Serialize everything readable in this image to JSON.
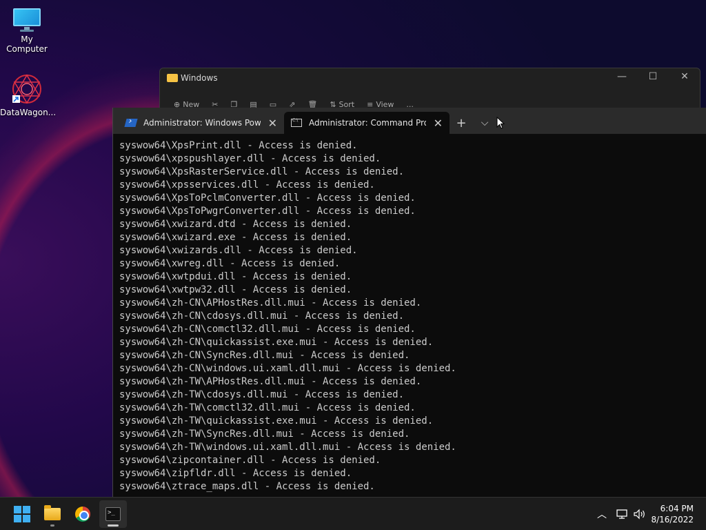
{
  "desktop": {
    "icons": [
      {
        "label": "My Computer",
        "icon": "monitor-icon"
      },
      {
        "label": "DataWagon...",
        "icon": "datawagon-icon"
      }
    ]
  },
  "explorer": {
    "title": "Windows",
    "toolbar": {
      "new_label": "New",
      "sort_label": "Sort",
      "view_label": "View",
      "more_label": "..."
    }
  },
  "terminal": {
    "tabs": [
      {
        "label": "Administrator: Windows PowerShell",
        "icon": "powershell-icon",
        "active": false
      },
      {
        "label": "Administrator: Command Prompt",
        "icon": "cmd-icon",
        "active": true
      }
    ],
    "new_tab_label": "+",
    "dropdown_label": "⌵",
    "lines": [
      "syswow64\\XpsPrint.dll - Access is denied.",
      "syswow64\\xpspushlayer.dll - Access is denied.",
      "syswow64\\XpsRasterService.dll - Access is denied.",
      "syswow64\\xpsservices.dll - Access is denied.",
      "syswow64\\XpsToPclmConverter.dll - Access is denied.",
      "syswow64\\XpsToPwgrConverter.dll - Access is denied.",
      "syswow64\\xwizard.dtd - Access is denied.",
      "syswow64\\xwizard.exe - Access is denied.",
      "syswow64\\xwizards.dll - Access is denied.",
      "syswow64\\xwreg.dll - Access is denied.",
      "syswow64\\xwtpdui.dll - Access is denied.",
      "syswow64\\xwtpw32.dll - Access is denied.",
      "syswow64\\zh-CN\\APHostRes.dll.mui - Access is denied.",
      "syswow64\\zh-CN\\cdosys.dll.mui - Access is denied.",
      "syswow64\\zh-CN\\comctl32.dll.mui - Access is denied.",
      "syswow64\\zh-CN\\quickassist.exe.mui - Access is denied.",
      "syswow64\\zh-CN\\SyncRes.dll.mui - Access is denied.",
      "syswow64\\zh-CN\\windows.ui.xaml.dll.mui - Access is denied.",
      "syswow64\\zh-TW\\APHostRes.dll.mui - Access is denied.",
      "syswow64\\zh-TW\\cdosys.dll.mui - Access is denied.",
      "syswow64\\zh-TW\\comctl32.dll.mui - Access is denied.",
      "syswow64\\zh-TW\\quickassist.exe.mui - Access is denied.",
      "syswow64\\zh-TW\\SyncRes.dll.mui - Access is denied.",
      "syswow64\\zh-TW\\windows.ui.xaml.dll.mui - Access is denied.",
      "syswow64\\zipcontainer.dll - Access is denied.",
      "syswow64\\zipfldr.dll - Access is denied.",
      "syswow64\\ztrace_maps.dll - Access is denied."
    ]
  },
  "taskbar": {
    "apps": [
      "start-icon",
      "file-explorer-icon",
      "chrome-icon",
      "terminal-icon"
    ],
    "clock": {
      "time": "6:04 PM",
      "date": "8/16/2022"
    }
  },
  "colors": {
    "accent": "#3fb0f2",
    "console_text": "#cccccc",
    "console_bg": "#0c0c0c"
  }
}
